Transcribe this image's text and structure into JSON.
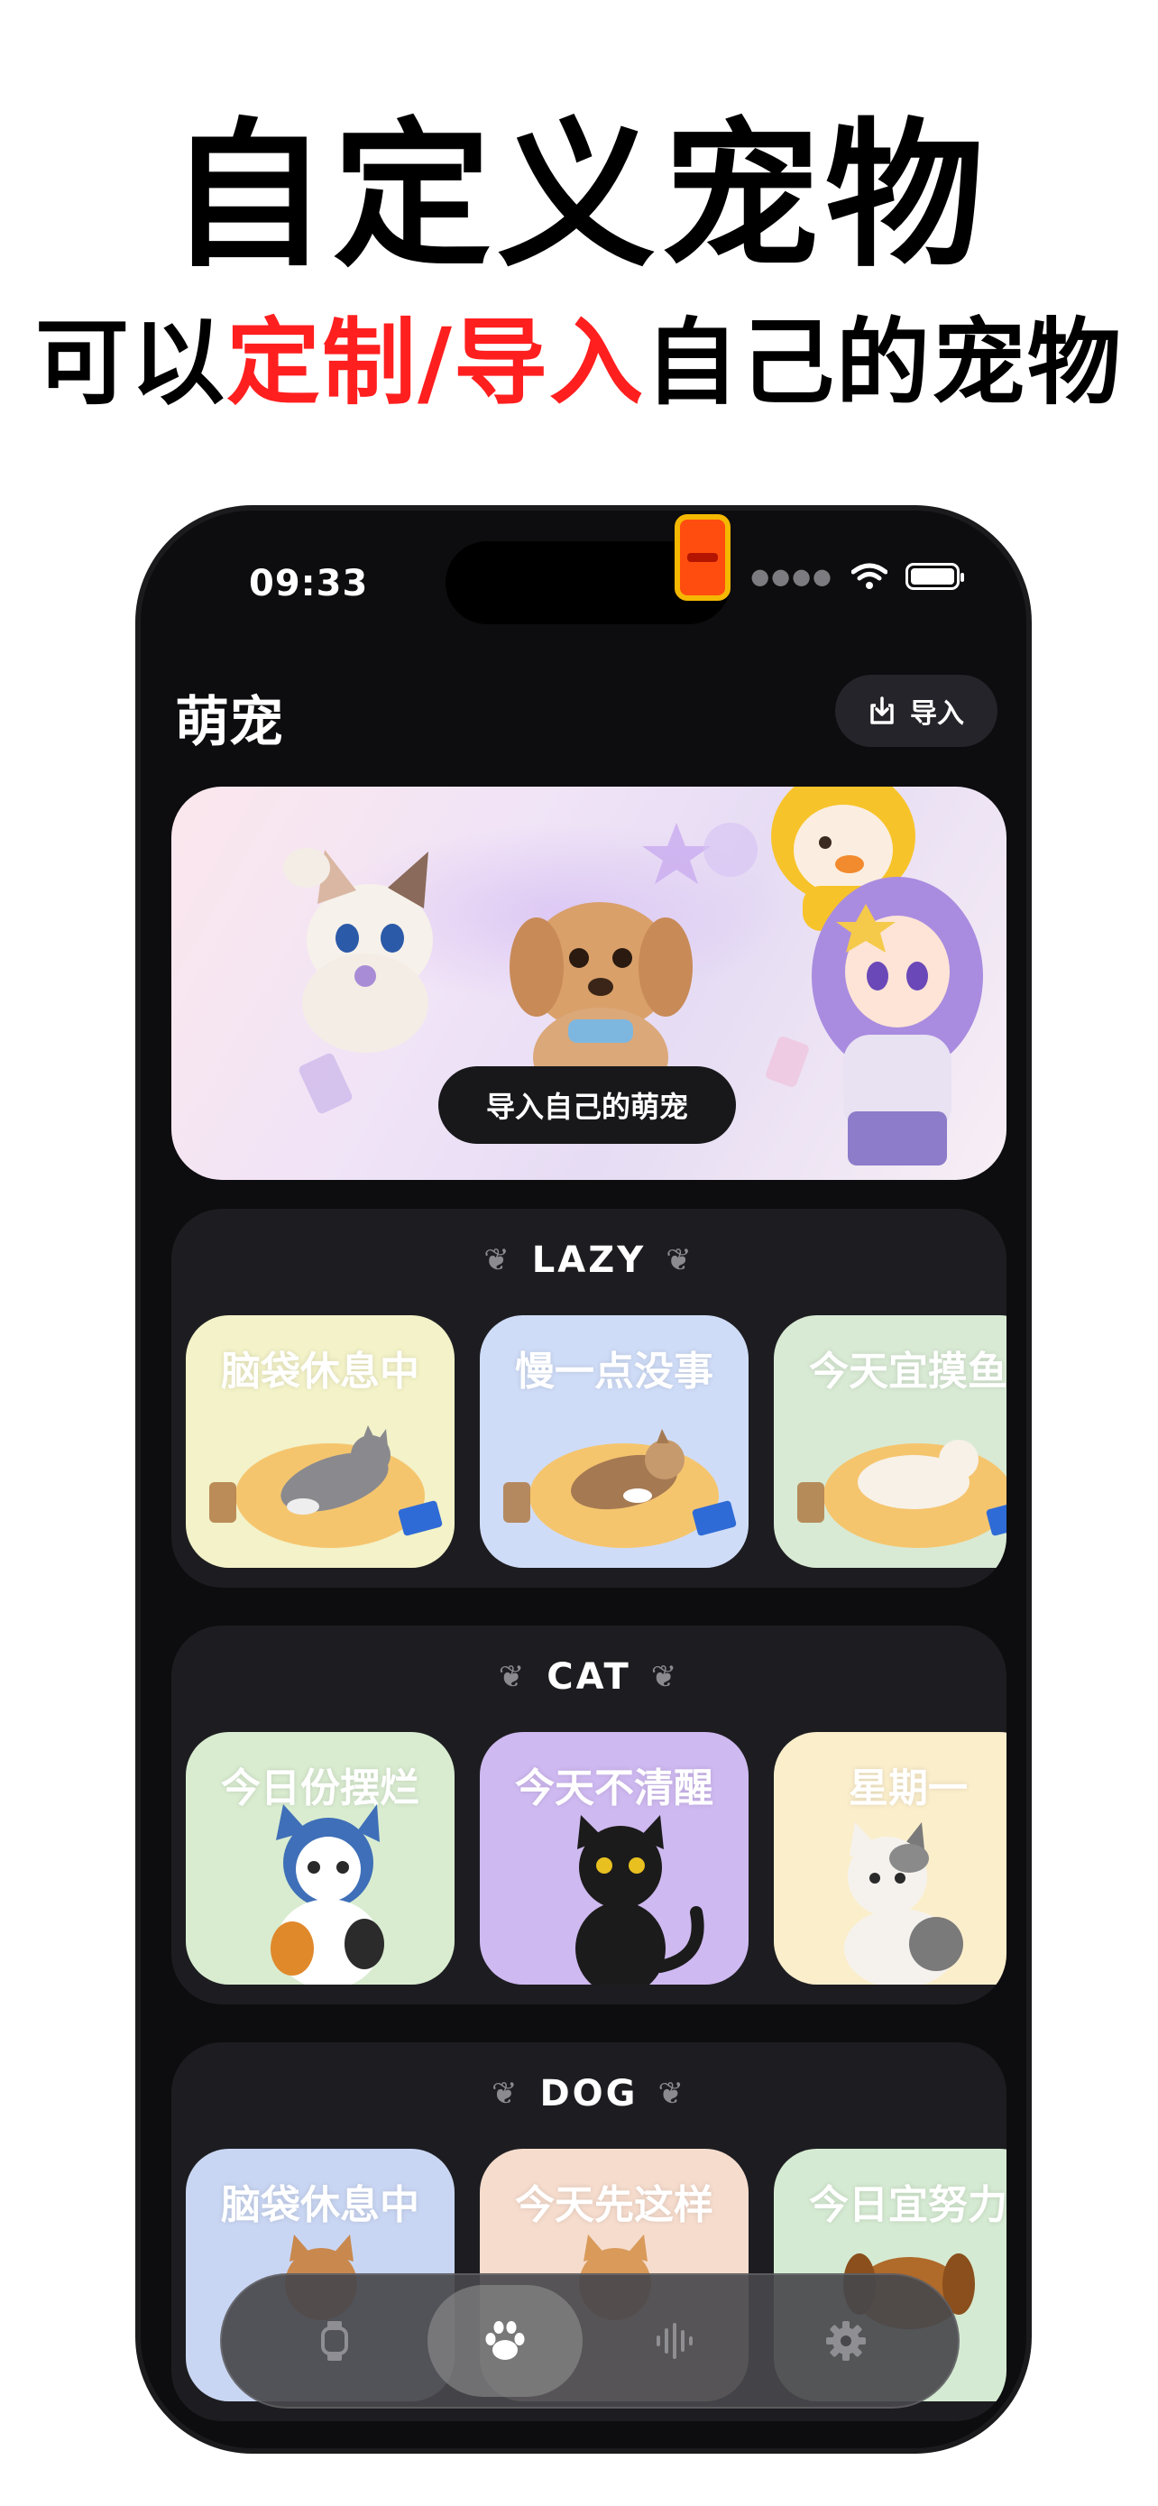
{
  "promo": {
    "headline": "自定义宠物",
    "sub_prefix": "可以",
    "sub_highlight": "定制/导入",
    "sub_suffix": "自己的宠物"
  },
  "status_bar": {
    "time": "09:33"
  },
  "header": {
    "title": "萌宠",
    "import_label": "导入"
  },
  "banner": {
    "cta": "导入自己的萌宠"
  },
  "sections": [
    {
      "title": "LAZY",
      "cards": [
        {
          "label": "脑袋休息中",
          "bg": "#f3f2c8"
        },
        {
          "label": "慢一点没事",
          "bg": "#cfdcf7"
        },
        {
          "label": "今天宜摸鱼",
          "bg": "#d8ead4"
        }
      ]
    },
    {
      "title": "CAT",
      "cards": [
        {
          "label": "今日份摆烂",
          "bg": "#d9ecd0"
        },
        {
          "label": "今天不清醒",
          "bg": "#cfb9f1"
        },
        {
          "label": "星期一",
          "bg": "#fbeecb"
        }
      ]
    },
    {
      "title": "DOG",
      "cards": [
        {
          "label": "脑袋休息中",
          "bg": "#c9d6f3"
        },
        {
          "label": "今天先这样",
          "bg": "#f6dccd"
        },
        {
          "label": "今日宜努力",
          "bg": "#d5ead2"
        }
      ]
    }
  ],
  "tabbar": {
    "items": [
      "watch-icon",
      "paw-icon",
      "voice-icon",
      "gear-icon"
    ],
    "active": "paw-icon"
  },
  "colors": {
    "accent_red": "#ff1f1f",
    "app_bg": "#0d0d0f",
    "section_bg": "#1d1d21"
  }
}
